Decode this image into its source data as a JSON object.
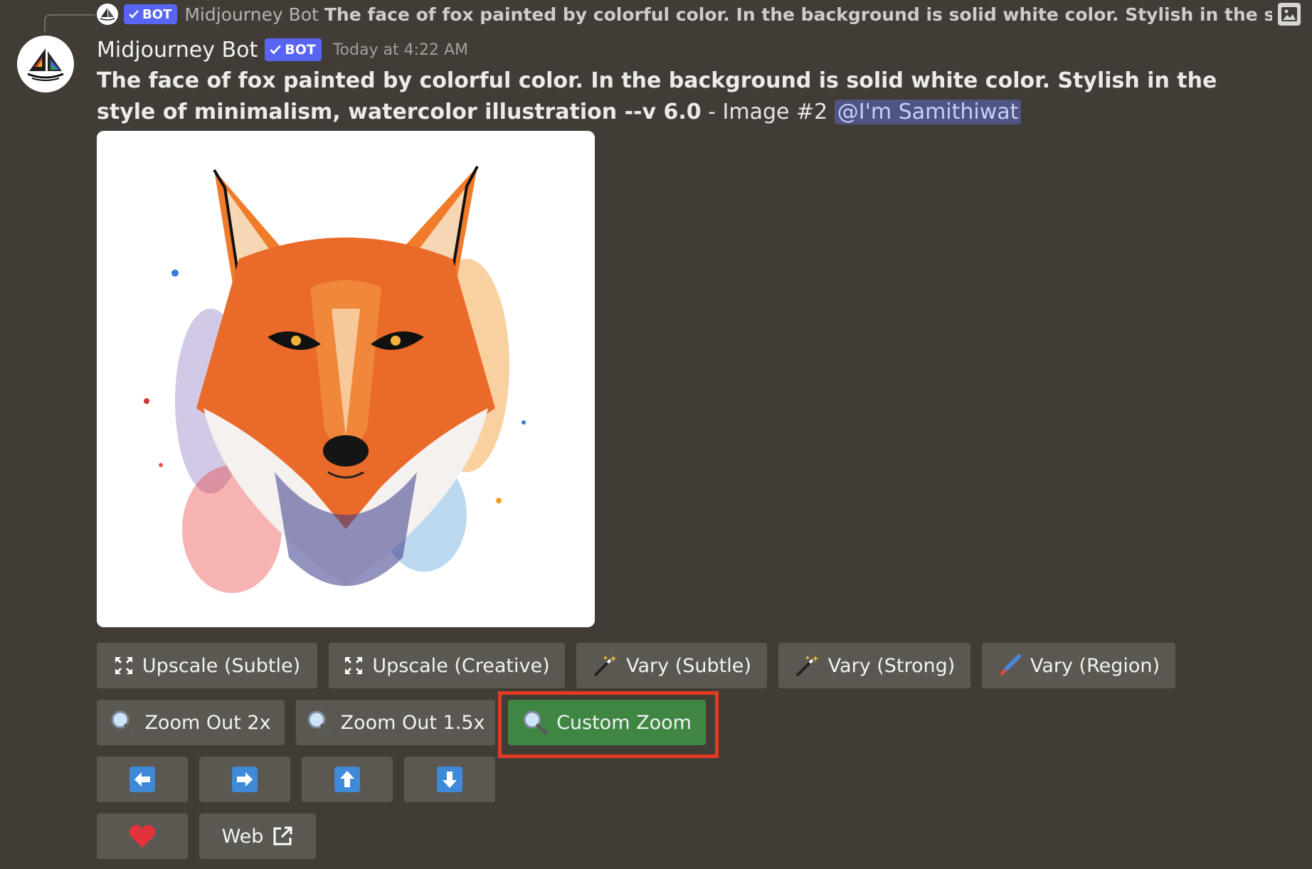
{
  "reply": {
    "bot_name": "Midjourney Bot",
    "badge": "BOT",
    "preview_text": "The face of fox painted by colorful color. In the background is solid white color. Stylish in the style of mir"
  },
  "message": {
    "username": "Midjourney Bot",
    "badge": "BOT",
    "timestamp": "Today at 4:22 AM",
    "prompt_bold": "The face of fox painted by colorful color. In the background is solid white color. Stylish in the style of minimalism, watercolor illustration --v 6.0",
    "suffix": " - Image #2 ",
    "mention": "@I'm Samithiwat"
  },
  "buttons": {
    "row1": [
      {
        "label": "Upscale (Subtle)",
        "icon": "expand-arrows-icon"
      },
      {
        "label": "Upscale (Creative)",
        "icon": "expand-arrows-icon"
      },
      {
        "label": "Vary (Subtle)",
        "icon": "magic-wand-icon"
      },
      {
        "label": "Vary (Strong)",
        "icon": "magic-wand-icon"
      },
      {
        "label": "Vary (Region)",
        "icon": "paintbrush-icon"
      }
    ],
    "row2": [
      {
        "label": "Zoom Out 2x",
        "icon": "magnifier-icon"
      },
      {
        "label": "Zoom Out 1.5x",
        "icon": "magnifier-icon"
      },
      {
        "label": "Custom Zoom",
        "icon": "magnifier-icon"
      }
    ],
    "row3": [
      "arrow-left-icon",
      "arrow-right-icon",
      "arrow-up-icon",
      "arrow-down-icon"
    ],
    "row4": [
      {
        "label": "",
        "icon": "heart-icon"
      },
      {
        "label": "Web",
        "icon": "external-link-icon"
      }
    ]
  },
  "colors": {
    "background": "#413d36",
    "button": "#5b5851",
    "button_highlighted": "#3f8643",
    "highlight_box": "#e53a22",
    "bot_badge": "#5865f2",
    "mention_bg": "#4f5483"
  }
}
